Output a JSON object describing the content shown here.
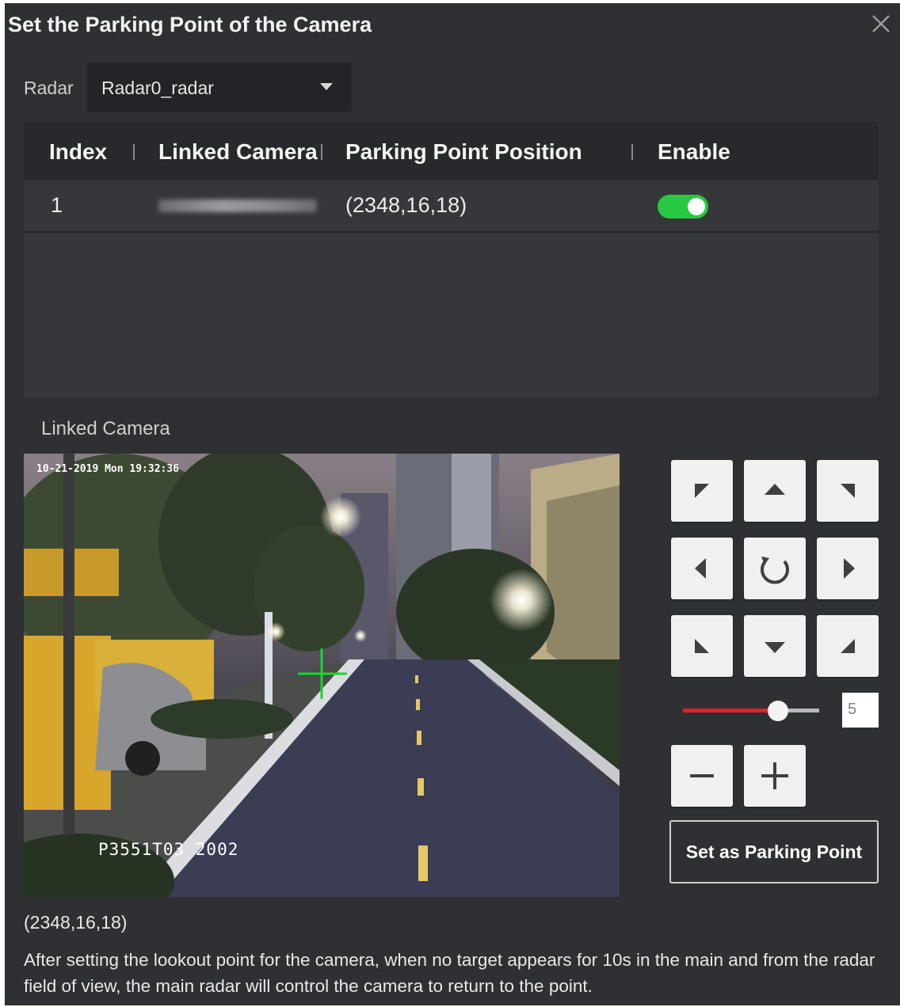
{
  "dialog": {
    "title": "Set the Parking Point of the Camera",
    "close_icon": "close-icon"
  },
  "radar": {
    "label": "Radar",
    "selected": "Radar0_radar"
  },
  "table": {
    "columns": [
      "Index",
      "Linked Camera",
      "Parking Point Position",
      "Enable"
    ],
    "rows": [
      {
        "index": "1",
        "linked_camera": "",
        "parking_point_position": "(2348,16,18)",
        "enabled": true
      }
    ]
  },
  "linked_camera": {
    "label": "Linked Camera",
    "osd_top": "10-21-2019 Mon 19:32:36",
    "osd_bottom": "P3551T03    2002"
  },
  "ptz": {
    "buttons": [
      "up-left",
      "up",
      "up-right",
      "left",
      "auto-rotate",
      "right",
      "down-left",
      "down",
      "down-right"
    ],
    "speed": "5",
    "speed_fraction": 0.7,
    "zoom_out_icon": "minus-icon",
    "zoom_in_icon": "plus-icon",
    "set_button": "Set as Parking Point"
  },
  "status": {
    "coords": "(2348,16,18)",
    "description": "After setting the lookout point for the camera, when no target appears for 10s in the main and from the radar field of view, the main radar will control the camera to return to the point."
  },
  "colors": {
    "dialog_bg": "#2f3033",
    "header_bg": "#28292c",
    "toggle_on": "#28c840",
    "slider_fill": "#e0202a",
    "crosshair": "#17d72a"
  }
}
